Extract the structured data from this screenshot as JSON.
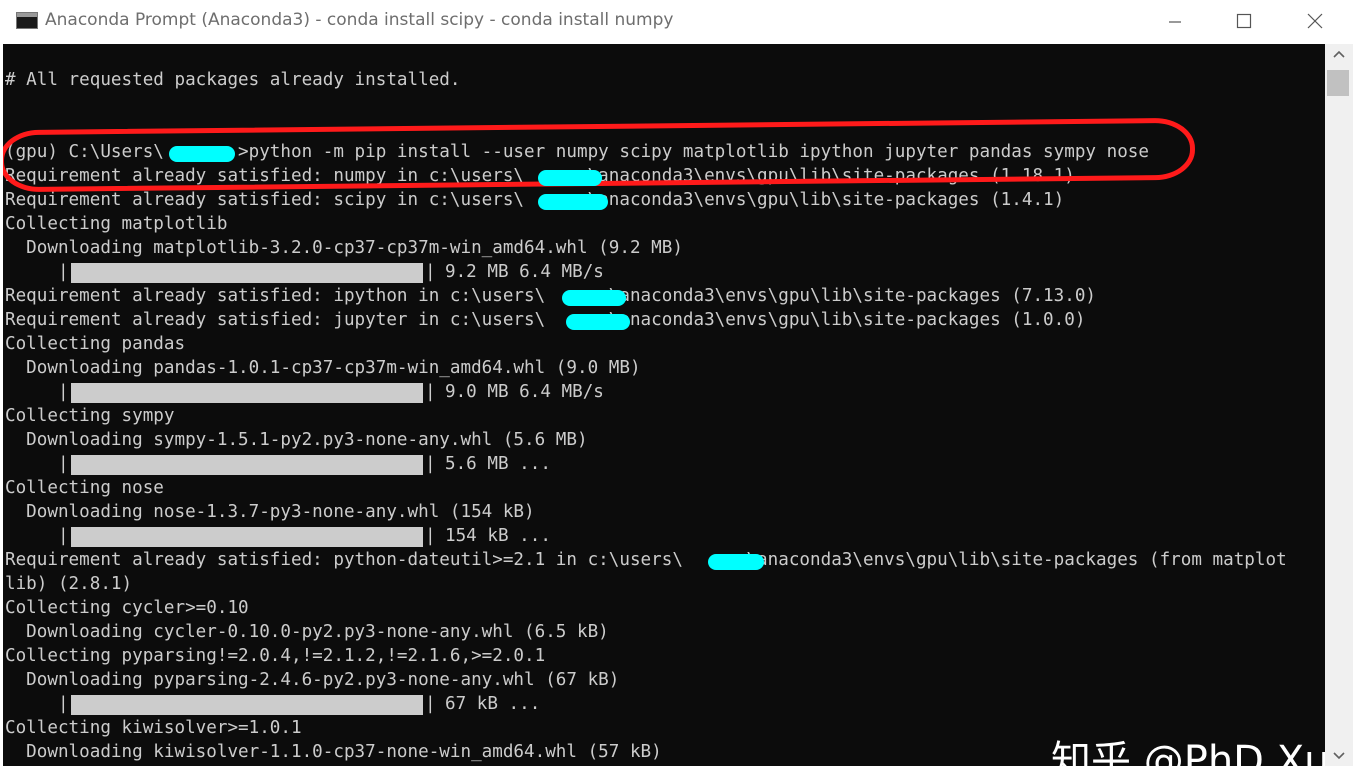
{
  "window": {
    "title": "Anaconda Prompt (Anaconda3) - conda  install scipy - conda  install numpy",
    "icon": "console-icon",
    "controls": {
      "minimize": "minimize-icon",
      "maximize": "maximize-icon",
      "close": "close-icon"
    }
  },
  "console": {
    "lines": [
      "# All requested packages already installed.",
      "",
      "",
      "(gpu) C:\\Users\\       >python -m pip install --user numpy scipy matplotlib ipython jupyter pandas sympy nose",
      "Requirement already satisfied: numpy in c:\\users\\      \\anaconda3\\envs\\gpu\\lib\\site-packages (1.18.1)",
      "Requirement already satisfied: scipy in c:\\users\\      \\anaconda3\\envs\\gpu\\lib\\site-packages (1.4.1)",
      "Collecting matplotlib",
      "  Downloading matplotlib-3.2.0-cp37-cp37m-win_amd64.whl (9.2 MB)",
      null,
      "Requirement already satisfied: ipython in c:\\users\\      \\anaconda3\\envs\\gpu\\lib\\site-packages (7.13.0)",
      "Requirement already satisfied: jupyter in c:\\users\\      \\anaconda3\\envs\\gpu\\lib\\site-packages (1.0.0)",
      "Collecting pandas",
      "  Downloading pandas-1.0.1-cp37-cp37m-win_amd64.whl (9.0 MB)",
      null,
      "Collecting sympy",
      "  Downloading sympy-1.5.1-py2.py3-none-any.whl (5.6 MB)",
      null,
      "Collecting nose",
      "  Downloading nose-1.3.7-py3-none-any.whl (154 kB)",
      null,
      "Requirement already satisfied: python-dateutil>=2.1 in c:\\users\\      \\anaconda3\\envs\\gpu\\lib\\site-packages (from matplot",
      "lib) (2.8.1)",
      "Collecting cycler>=0.10",
      "  Downloading cycler-0.10.0-py2.py3-none-any.whl (6.5 kB)",
      "Collecting pyparsing!=2.0.4,!=2.1.2,!=2.1.6,>=2.0.1",
      "  Downloading pyparsing-2.4.6-py2.py3-none-any.whl (67 kB)",
      null,
      "Collecting kiwisolver>=1.0.1",
      "  Downloading kiwisolver-1.1.0-cp37-none-win_amd64.whl (57 kB)"
    ],
    "progress_bars": [
      {
        "line": 8,
        "fraction": 1.0,
        "stats": "9.2 MB 6.4 MB/s"
      },
      {
        "line": 13,
        "fraction": 1.0,
        "stats": "9.0 MB 6.4 MB/s"
      },
      {
        "line": 16,
        "fraction": 1.0,
        "stats": "5.6 MB ..."
      },
      {
        "line": 19,
        "fraction": 1.0,
        "stats": "154 kB ..."
      },
      {
        "line": 26,
        "fraction": 1.0,
        "stats": "67 kB ..."
      }
    ],
    "text_color": "#cccccc",
    "background": "#0c0c0c"
  },
  "annotations": {
    "highlight_color": "#ff1a1a",
    "redaction_color": "#00ffff"
  },
  "watermark": {
    "text": "知乎 @PhD Xu"
  },
  "scrollbar": {
    "up": "scroll-up-arrow-icon",
    "down": "scroll-down-arrow-icon"
  }
}
